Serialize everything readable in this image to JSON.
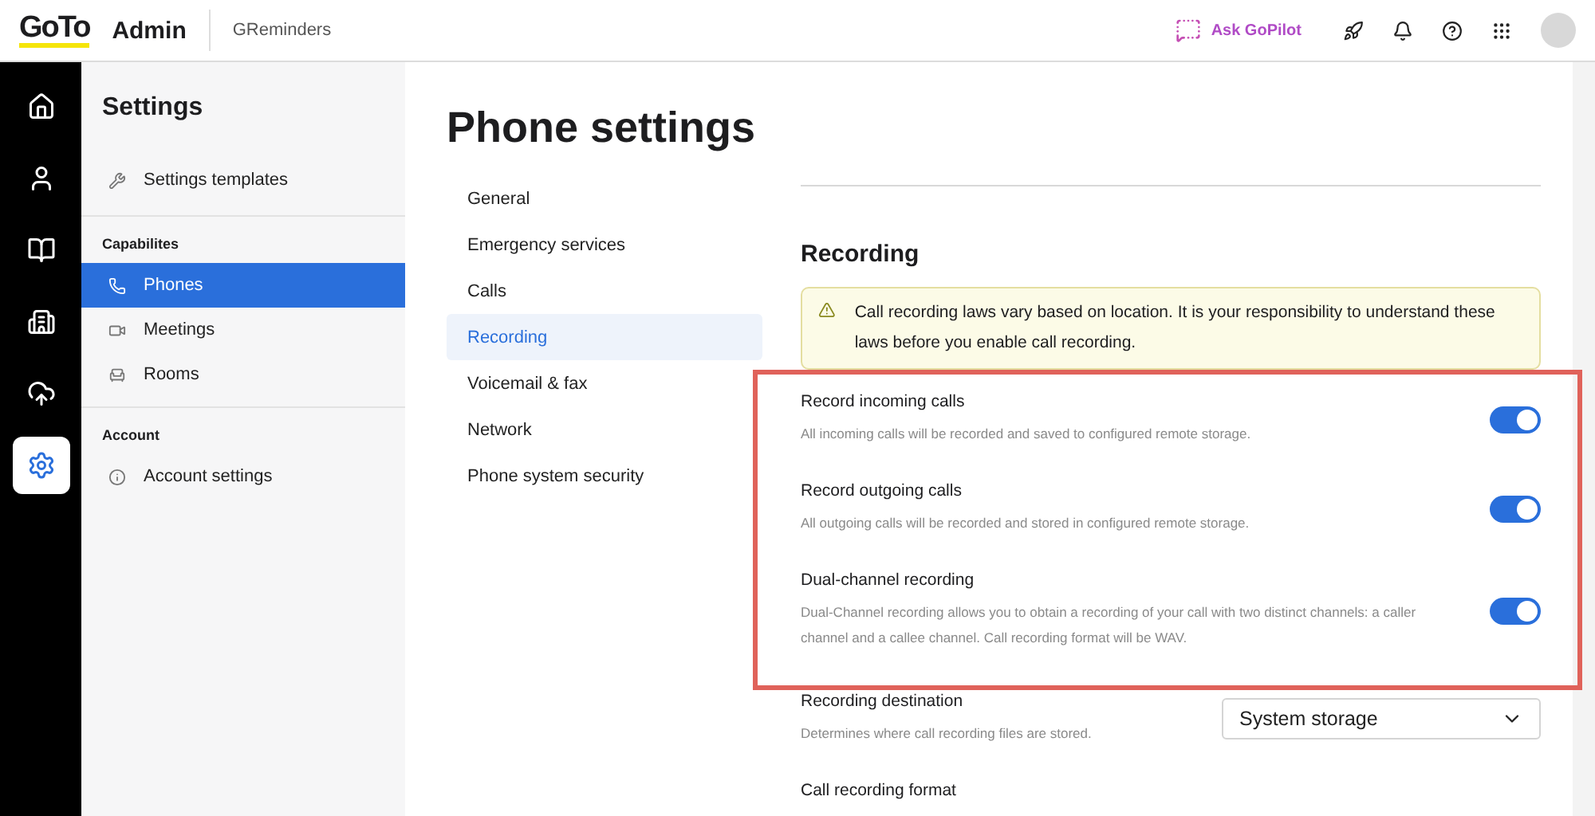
{
  "header": {
    "logo": "GoTo",
    "app": "Admin",
    "org": "GReminders",
    "assistant": "Ask GoPilot"
  },
  "rail": [
    {
      "kind": "home",
      "selected": false
    },
    {
      "kind": "user",
      "selected": false
    },
    {
      "kind": "directory",
      "selected": false
    },
    {
      "kind": "devices",
      "selected": false
    },
    {
      "kind": "cloud",
      "selected": false
    },
    {
      "kind": "settings",
      "selected": true
    }
  ],
  "sidebar": {
    "title": "Settings",
    "sections": [
      {
        "items": [
          {
            "label": "Settings templates",
            "kind": "wrench",
            "selected": false
          }
        ]
      },
      {
        "heading": "Capabilites",
        "items": [
          {
            "label": "Phones",
            "kind": "phone",
            "selected": true
          },
          {
            "label": "Meetings",
            "kind": "video",
            "selected": false
          },
          {
            "label": "Rooms",
            "kind": "seats",
            "selected": false
          }
        ]
      },
      {
        "heading": "Account",
        "items": [
          {
            "label": "Account settings",
            "kind": "info",
            "selected": false
          }
        ]
      }
    ]
  },
  "page": {
    "title": "Phone settings",
    "nav": [
      {
        "label": "General",
        "selected": false
      },
      {
        "label": "Emergency services",
        "selected": false
      },
      {
        "label": "Calls",
        "selected": false
      },
      {
        "label": "Recording",
        "selected": true
      },
      {
        "label": "Voicemail & fax",
        "selected": false
      },
      {
        "label": "Network",
        "selected": false
      },
      {
        "label": "Phone system security",
        "selected": false
      }
    ],
    "section": "Recording",
    "alert": "Call recording laws vary based on location. It is your responsibility to understand these laws before you enable call recording.",
    "settings": [
      {
        "kind": "toggle",
        "title": "Record incoming calls",
        "description": "All incoming calls will be recorded and saved to configured remote storage.",
        "on": true
      },
      {
        "kind": "toggle",
        "title": "Record outgoing calls",
        "description": "All outgoing calls will be recorded and stored in configured remote storage.",
        "on": true
      },
      {
        "kind": "toggle",
        "title": "Dual-channel recording",
        "description": "Dual-Channel recording allows you to obtain a recording of your call with two distinct channels: a caller channel and a callee channel. Call recording format will be WAV.",
        "on": true
      },
      {
        "kind": "select",
        "title": "Recording destination",
        "description": "Determines where call recording files are stored.",
        "value": "System storage"
      },
      {
        "kind": "heading",
        "title": "Call recording format"
      }
    ]
  }
}
